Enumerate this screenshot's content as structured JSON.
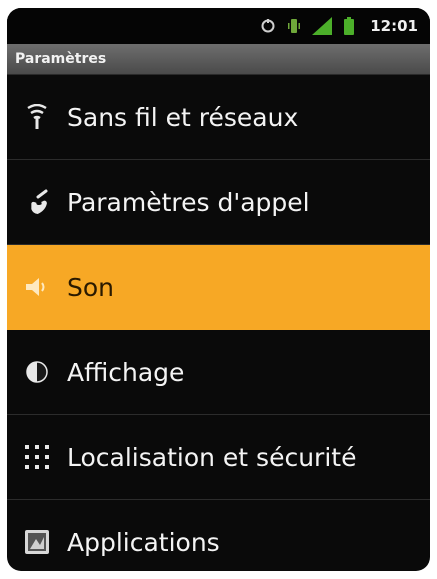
{
  "status_bar": {
    "time": "12:01",
    "icons": [
      "sync-icon",
      "vibrate-icon",
      "signal-icon",
      "battery-icon"
    ]
  },
  "title_bar": {
    "title": "Paramètres"
  },
  "menu": {
    "items": [
      {
        "label": "Sans fil et réseaux",
        "icon": "wifi-icon"
      },
      {
        "label": "Paramètres d'appel",
        "icon": "phone-icon"
      },
      {
        "label": "Son",
        "icon": "speaker-icon",
        "selected": true
      },
      {
        "label": "Affichage",
        "icon": "brightness-icon"
      },
      {
        "label": "Localisation et sécurité",
        "icon": "location-grid-icon"
      },
      {
        "label": "Applications",
        "icon": "applications-icon"
      }
    ]
  },
  "colors": {
    "selected_background": "#f7a825",
    "background": "#0a0a0a",
    "text": "#f4f4f4",
    "signal": "#4caf2a"
  }
}
